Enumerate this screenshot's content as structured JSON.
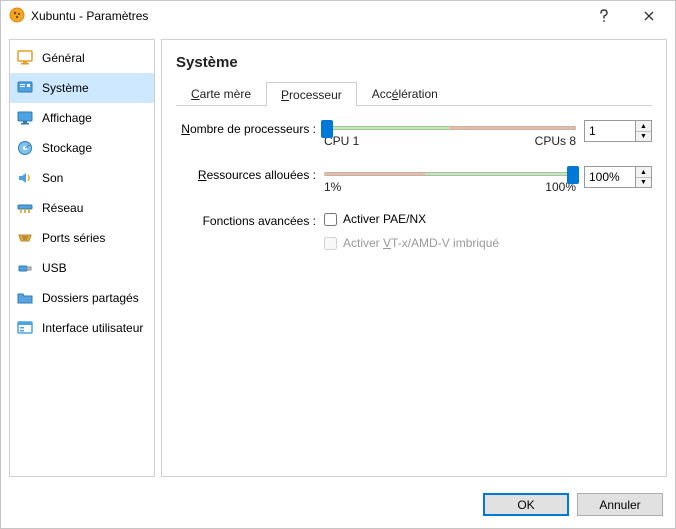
{
  "window": {
    "title": "Xubuntu - Paramètres"
  },
  "sidebar": {
    "items": [
      {
        "label": "Général"
      },
      {
        "label": "Système"
      },
      {
        "label": "Affichage"
      },
      {
        "label": "Stockage"
      },
      {
        "label": "Son"
      },
      {
        "label": "Réseau"
      },
      {
        "label": "Ports séries"
      },
      {
        "label": "USB"
      },
      {
        "label": "Dossiers partagés"
      },
      {
        "label": "Interface utilisateur"
      }
    ],
    "active_index": 1
  },
  "page": {
    "title": "Système"
  },
  "tabs": {
    "items": [
      {
        "label_ul": "C",
        "label_rest": "arte mère"
      },
      {
        "label_ul": "P",
        "label_rest": "rocesseur"
      },
      {
        "label_ul1": "Acc",
        "label_ul": "é",
        "label_rest": "lération"
      }
    ],
    "active_index": 1
  },
  "proc": {
    "count_label": "Nombre de processeurs :",
    "count_min_label": "CPU 1",
    "count_max_label": "CPUs 8",
    "count_value": "1",
    "alloc_label": "Ressources allouées :",
    "alloc_min_label": "1%",
    "alloc_max_label": "100%",
    "alloc_value": "100%",
    "adv_label": "Fonctions avancées :",
    "pae_label": "Activer PAE/NX",
    "vtx_prefix": "Activer ",
    "vtx_ul": "V",
    "vtx_rest": "T-x/AMD-V imbriqué"
  },
  "footer": {
    "ok": "OK",
    "cancel": "Annuler"
  },
  "ul": {
    "n": "N",
    "r": "R"
  }
}
